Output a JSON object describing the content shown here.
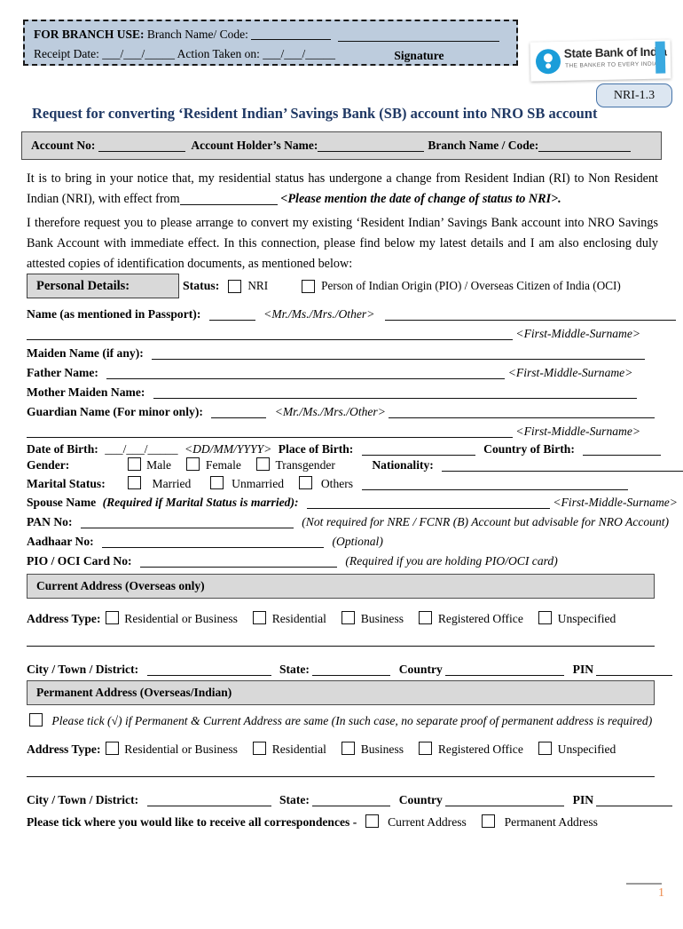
{
  "branch_use": {
    "title": "FOR BRANCH USE:",
    "branch_name_label": "Branch Name/ Code:",
    "receipt_date_label": "Receipt Date:",
    "receipt_date_value": "___/___/_____",
    "action_taken_label": "Action Taken on:",
    "action_taken_value": "___/___/_____",
    "signature_label": "Signature"
  },
  "logo": {
    "bank_name": "State Bank of India",
    "tagline": "THE BANKER TO EVERY INDIAN",
    "form_code": "NRI-1.3"
  },
  "title": "Request for converting ‘Resident Indian’ Savings Bank (SB) account into NRO SB account",
  "account_bar": {
    "account_no_label": "Account No:",
    "holder_name_label": "Account Holder’s Name:",
    "branch_name_label": "Branch Name / Code:"
  },
  "paragraphs": {
    "p1_a": "It is to bring in your notice that, my residential status has undergone a change from Resident Indian (RI) to Non Resident Indian (NRI), with effect from",
    "p1_hint": "<Please mention the date of change of status to NRI>.",
    "p2": "I therefore request you to please arrange to convert my existing ‘Resident Indian’ Savings Bank account into NRO Savings Bank Account with immediate effect. In this connection, please find below my latest details and I am also enclosing duly attested copies of identification documents, as mentioned below:"
  },
  "personal_details": {
    "section_label": "Personal Details:",
    "status_label": "Status:",
    "status_options": [
      {
        "label": "NRI"
      },
      {
        "label": "Person of Indian Origin (PIO) / Overseas Citizen of India (OCI)"
      }
    ],
    "name_label": "Name (as mentioned in Passport):",
    "title_hint": "<Mr./Ms./Mrs./Other>",
    "name_format_hint": "<First-Middle-Surname>",
    "maiden_name_label": "Maiden Name (if any):",
    "father_name_label": "Father Name:",
    "mother_maiden_label": "Mother Maiden Name:",
    "guardian_label": "Guardian Name (For minor only):",
    "dob_label": "Date of Birth:",
    "dob_value": "___/___/_____",
    "dob_hint": "<DD/MM/YYYY>",
    "place_of_birth_label": "Place of Birth:",
    "country_of_birth_label": "Country of Birth:",
    "gender_label": "Gender:",
    "gender_options": [
      "Male",
      "Female",
      "Transgender"
    ],
    "nationality_label": "Nationality:",
    "marital_label": "Marital Status:",
    "marital_options": [
      "Married",
      "Unmarried",
      "Others"
    ],
    "spouse_label": "Spouse Name",
    "spouse_hint": "(Required if Marital Status is married):",
    "pan_label": "PAN No:",
    "pan_hint": "(Not required for NRE / FCNR (B) Account but advisable for NRO Account)",
    "aadhaar_label": "Aadhaar No:",
    "aadhaar_hint": "(Optional)",
    "pio_label": "PIO / OCI Card No:",
    "pio_hint": "(Required if you are holding PIO/OCI card)"
  },
  "current_address": {
    "section_label": "Current Address (Overseas only)",
    "address_type_label": "Address Type:",
    "address_type_options": [
      "Residential or Business",
      "Residential",
      "Business",
      "Registered Office",
      "Unspecified"
    ],
    "city_label": "City / Town / District:",
    "state_label": "State:",
    "country_label": "Country",
    "pin_label": "PIN"
  },
  "permanent_address": {
    "section_label": "Permanent Address (Overseas/Indian)",
    "same_as_current_note": "Please tick (√) if Permanent & Current Address are same (In such case, no separate proof of permanent address is required)",
    "address_type_label": "Address Type:",
    "address_type_options": [
      "Residential or Business",
      "Residential",
      "Business",
      "Registered Office",
      "Unspecified"
    ],
    "city_label": "City / Town / District:",
    "state_label": "State:",
    "country_label": "Country",
    "pin_label": "PIN"
  },
  "correspondence": {
    "label": "Please tick where you would like to receive all correspondences -",
    "options": [
      "Current Address",
      "Permanent Address"
    ]
  },
  "footer": {
    "page_number": "1"
  },
  "colors": {
    "title_blue": "#1f3864",
    "branch_box_fill": "#bdccdd",
    "section_grey": "#d9d9d9",
    "badge_fill": "#dce6f1",
    "badge_border": "#4472a8",
    "logo_blue": "#1b9dd9",
    "page_number": "#ed8b4e"
  }
}
